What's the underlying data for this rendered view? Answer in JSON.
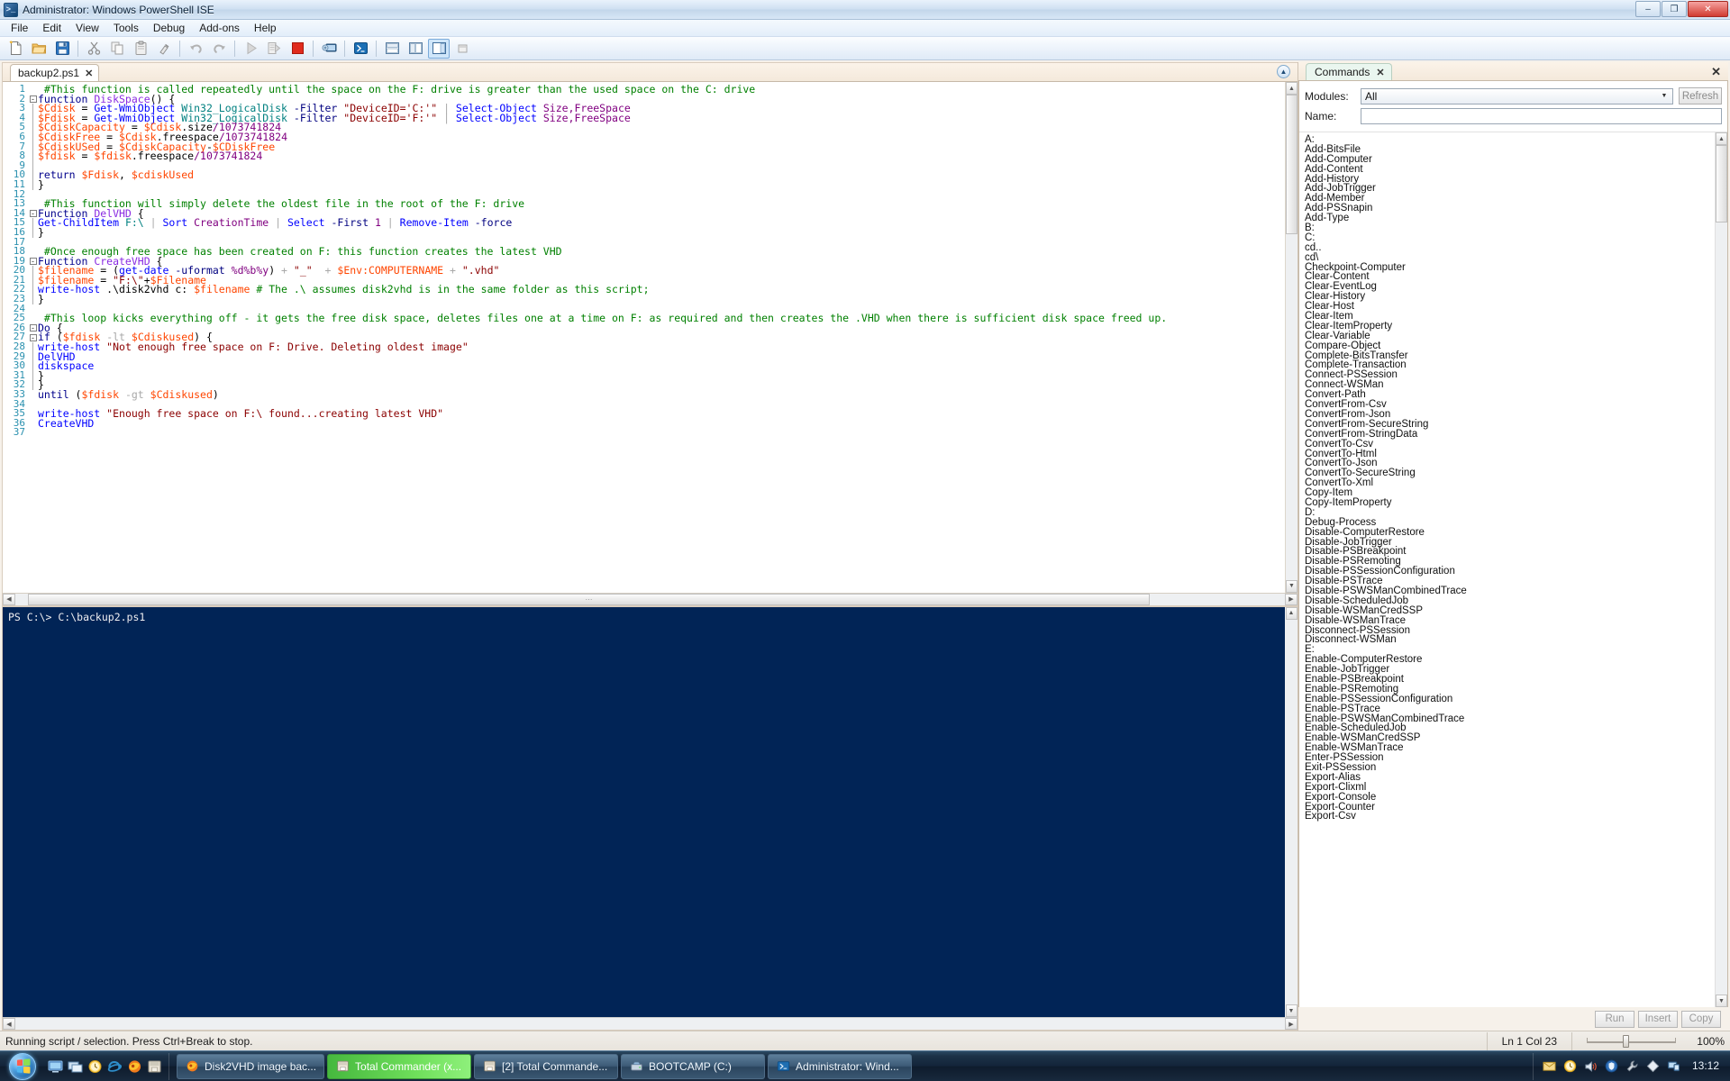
{
  "window": {
    "title": "Administrator: Windows PowerShell ISE",
    "app_icon": "powershell-ise-icon",
    "minimize_label": "–",
    "maximize_label": "❐",
    "close_label": "✕"
  },
  "menu": {
    "items": [
      {
        "label": "File"
      },
      {
        "label": "Edit"
      },
      {
        "label": "View"
      },
      {
        "label": "Tools"
      },
      {
        "label": "Debug"
      },
      {
        "label": "Add-ons"
      },
      {
        "label": "Help"
      }
    ]
  },
  "toolbar": {
    "buttons": [
      {
        "name": "new-script-icon",
        "title": "New"
      },
      {
        "name": "open-folder-icon",
        "title": "Open"
      },
      {
        "name": "save-icon",
        "title": "Save"
      },
      {
        "name": "cut-scissors-icon",
        "title": "Cut"
      },
      {
        "name": "copy-icon",
        "title": "Copy"
      },
      {
        "name": "paste-clipboard-icon",
        "title": "Paste"
      },
      {
        "name": "clear-console-icon",
        "title": "Clear Console Pane"
      },
      {
        "name": "undo-icon",
        "title": "Undo"
      },
      {
        "name": "redo-icon",
        "title": "Redo"
      },
      {
        "name": "run-script-icon",
        "title": "Run Script"
      },
      {
        "name": "run-selection-icon",
        "title": "Run Selection"
      },
      {
        "name": "stop-operation-icon",
        "title": "Stop Operation"
      },
      {
        "name": "new-remote-session-icon",
        "title": "New Remote PowerShell Tab"
      },
      {
        "name": "start-powershell-icon",
        "title": "Start PowerShell.exe"
      },
      {
        "name": "layout-horizontal-icon",
        "title": "Show Script Pane Top"
      },
      {
        "name": "layout-vertical-icon",
        "title": "Show Script Pane Right"
      },
      {
        "name": "show-command-addon-icon",
        "title": "Show Command Add-on"
      },
      {
        "name": "show-commands-pane-icon",
        "title": "Show Commands Pane"
      }
    ]
  },
  "script_pane": {
    "tab_label": "backup2.ps1",
    "tab_close": "✕",
    "collapse_icon": "▲",
    "lines": [
      {
        "n": 1,
        "fold": "",
        "bar": false,
        "tokens": [
          {
            "c": "t-cmt",
            "t": " #This function is called repeatedly until the space on the F: drive is greater than the used space on the C: drive"
          }
        ]
      },
      {
        "n": 2,
        "fold": "-",
        "bar": false,
        "tokens": [
          {
            "c": "t-kw",
            "t": "function "
          },
          {
            "c": "t-fnname",
            "t": "DiskSpace"
          },
          {
            "c": "t-plain",
            "t": "() {"
          }
        ]
      },
      {
        "n": 3,
        "fold": "",
        "bar": true,
        "tokens": [
          {
            "c": "t-var",
            "t": "$Cdisk"
          },
          {
            "c": "t-plain",
            "t": " = "
          },
          {
            "c": "t-cmd",
            "t": "Get-WmiObject "
          },
          {
            "c": "t-type",
            "t": "Win32_LogicalDisk "
          },
          {
            "c": "t-param",
            "t": "-Filter "
          },
          {
            "c": "t-str",
            "t": "\"DeviceID='C:'\""
          },
          {
            "c": "t-op",
            "t": " | "
          },
          {
            "c": "t-cmd",
            "t": "Select-Object "
          },
          {
            "c": "t-attr",
            "t": "Size,FreeSpace"
          }
        ]
      },
      {
        "n": 4,
        "fold": "",
        "bar": true,
        "tokens": [
          {
            "c": "t-var",
            "t": "$Fdisk"
          },
          {
            "c": "t-plain",
            "t": " = "
          },
          {
            "c": "t-cmd",
            "t": "Get-WmiObject "
          },
          {
            "c": "t-type",
            "t": "Win32_LogicalDisk "
          },
          {
            "c": "t-param",
            "t": "-Filter "
          },
          {
            "c": "t-str",
            "t": "\"DeviceID='F:'\""
          },
          {
            "c": "t-op",
            "t": " | "
          },
          {
            "c": "t-cmd",
            "t": "Select-Object "
          },
          {
            "c": "t-attr",
            "t": "Size,FreeSpace"
          }
        ]
      },
      {
        "n": 5,
        "fold": "",
        "bar": true,
        "tokens": [
          {
            "c": "t-var",
            "t": "$CdiskCapacity"
          },
          {
            "c": "t-plain",
            "t": " = "
          },
          {
            "c": "t-var",
            "t": "$Cdisk"
          },
          {
            "c": "t-plain",
            "t": ".size"
          },
          {
            "c": "t-num",
            "t": "/1073741824"
          }
        ]
      },
      {
        "n": 6,
        "fold": "",
        "bar": true,
        "tokens": [
          {
            "c": "t-var",
            "t": "$CdiskFree"
          },
          {
            "c": "t-plain",
            "t": " = "
          },
          {
            "c": "t-var",
            "t": "$Cdisk"
          },
          {
            "c": "t-plain",
            "t": ".freespace"
          },
          {
            "c": "t-num",
            "t": "/1073741824"
          }
        ]
      },
      {
        "n": 7,
        "fold": "",
        "bar": true,
        "tokens": [
          {
            "c": "t-var",
            "t": "$CdiskUSed"
          },
          {
            "c": "t-plain",
            "t": " = "
          },
          {
            "c": "t-var",
            "t": "$CdiskCapacity"
          },
          {
            "c": "t-plain",
            "t": "-"
          },
          {
            "c": "t-var",
            "t": "$CDiskFree"
          }
        ]
      },
      {
        "n": 8,
        "fold": "",
        "bar": true,
        "tokens": [
          {
            "c": "t-var",
            "t": "$fdisk"
          },
          {
            "c": "t-plain",
            "t": " = "
          },
          {
            "c": "t-var",
            "t": "$fdisk"
          },
          {
            "c": "t-plain",
            "t": ".freespace"
          },
          {
            "c": "t-num",
            "t": "/1073741824"
          }
        ]
      },
      {
        "n": 9,
        "fold": "",
        "bar": true,
        "tokens": []
      },
      {
        "n": 10,
        "fold": "",
        "bar": true,
        "tokens": [
          {
            "c": "t-kw",
            "t": "return "
          },
          {
            "c": "t-var",
            "t": "$Fdisk"
          },
          {
            "c": "t-plain",
            "t": ", "
          },
          {
            "c": "t-var",
            "t": "$cdiskUsed"
          }
        ]
      },
      {
        "n": 11,
        "fold": "",
        "bar": true,
        "tokens": [
          {
            "c": "t-plain",
            "t": "}"
          }
        ]
      },
      {
        "n": 12,
        "fold": "",
        "bar": false,
        "tokens": []
      },
      {
        "n": 13,
        "fold": "",
        "bar": false,
        "tokens": [
          {
            "c": "t-cmt",
            "t": " #This function will simply delete the oldest file in the root of the F: drive"
          }
        ]
      },
      {
        "n": 14,
        "fold": "-",
        "bar": false,
        "tokens": [
          {
            "c": "t-kw",
            "t": "Function "
          },
          {
            "c": "t-fnname",
            "t": "DelVHD"
          },
          {
            "c": "t-plain",
            "t": " {"
          }
        ]
      },
      {
        "n": 15,
        "fold": "",
        "bar": true,
        "tokens": [
          {
            "c": "t-cmd",
            "t": "Get-ChildItem "
          },
          {
            "c": "t-type",
            "t": "F:\\"
          },
          {
            "c": "t-op",
            "t": " | "
          },
          {
            "c": "t-cmd",
            "t": "Sort "
          },
          {
            "c": "t-attr",
            "t": "CreationTime"
          },
          {
            "c": "t-op",
            "t": " | "
          },
          {
            "c": "t-cmd",
            "t": "Select "
          },
          {
            "c": "t-param",
            "t": "-First "
          },
          {
            "c": "t-num",
            "t": "1"
          },
          {
            "c": "t-op",
            "t": " | "
          },
          {
            "c": "t-cmd",
            "t": "Remove-Item "
          },
          {
            "c": "t-param",
            "t": "-force"
          }
        ]
      },
      {
        "n": 16,
        "fold": "",
        "bar": true,
        "tokens": [
          {
            "c": "t-plain",
            "t": "}"
          }
        ]
      },
      {
        "n": 17,
        "fold": "",
        "bar": false,
        "tokens": []
      },
      {
        "n": 18,
        "fold": "",
        "bar": false,
        "tokens": [
          {
            "c": "t-cmt",
            "t": " #Once enough free space has been created on F: this function creates the latest VHD"
          }
        ]
      },
      {
        "n": 19,
        "fold": "-",
        "bar": false,
        "tokens": [
          {
            "c": "t-kw",
            "t": "Function "
          },
          {
            "c": "t-fnname",
            "t": "CreateVHD"
          },
          {
            "c": "t-plain",
            "t": " {"
          }
        ]
      },
      {
        "n": 20,
        "fold": "",
        "bar": true,
        "tokens": [
          {
            "c": "t-var",
            "t": "$filename"
          },
          {
            "c": "t-plain",
            "t": " = ("
          },
          {
            "c": "t-cmd",
            "t": "get-date "
          },
          {
            "c": "t-param",
            "t": "-uformat "
          },
          {
            "c": "t-attr",
            "t": "%d%b%y"
          },
          {
            "c": "t-plain",
            "t": ")"
          },
          {
            "c": "t-op",
            "t": " + "
          },
          {
            "c": "t-str",
            "t": "\"_\""
          },
          {
            "c": "t-op",
            "t": "  + "
          },
          {
            "c": "t-var",
            "t": "$Env:COMPUTERNAME"
          },
          {
            "c": "t-op",
            "t": " + "
          },
          {
            "c": "t-str",
            "t": "\".vhd\""
          }
        ]
      },
      {
        "n": 21,
        "fold": "",
        "bar": true,
        "tokens": [
          {
            "c": "t-var",
            "t": "$filename"
          },
          {
            "c": "t-plain",
            "t": " = "
          },
          {
            "c": "t-str",
            "t": "\"F:\\\""
          },
          {
            "c": "t-plain",
            "t": "+"
          },
          {
            "c": "t-var",
            "t": "$Filename"
          }
        ]
      },
      {
        "n": 22,
        "fold": "",
        "bar": true,
        "tokens": [
          {
            "c": "t-cmd",
            "t": "write-host "
          },
          {
            "c": "t-plain",
            "t": ".\\disk2vhd c: "
          },
          {
            "c": "t-var",
            "t": "$filename"
          },
          {
            "c": "t-cmt",
            "t": " # The .\\ assumes disk2vhd is in the same folder as this script;"
          }
        ]
      },
      {
        "n": 23,
        "fold": "",
        "bar": true,
        "tokens": [
          {
            "c": "t-plain",
            "t": "}"
          }
        ]
      },
      {
        "n": 24,
        "fold": "",
        "bar": false,
        "tokens": []
      },
      {
        "n": 25,
        "fold": "",
        "bar": false,
        "tokens": [
          {
            "c": "t-cmt",
            "t": " #This loop kicks everything off - it gets the free disk space, deletes files one at a time on F: as required and then creates the .VHD when there is sufficient disk space freed up."
          }
        ]
      },
      {
        "n": 26,
        "fold": "-",
        "bar": false,
        "tokens": [
          {
            "c": "t-kw",
            "t": "Do"
          },
          {
            "c": "t-plain",
            "t": " {"
          }
        ]
      },
      {
        "n": 27,
        "fold": "-",
        "bar": false,
        "tokens": [
          {
            "c": "t-kw",
            "t": "if"
          },
          {
            "c": "t-plain",
            "t": " ("
          },
          {
            "c": "t-var",
            "t": "$fdisk"
          },
          {
            "c": "t-op",
            "t": " -lt "
          },
          {
            "c": "t-var",
            "t": "$Cdiskused"
          },
          {
            "c": "t-plain",
            "t": ") {"
          }
        ]
      },
      {
        "n": 28,
        "fold": "",
        "bar": true,
        "tokens": [
          {
            "c": "t-cmd",
            "t": "write-host "
          },
          {
            "c": "t-str",
            "t": "\"Not enough free space on F: Drive. Deleting oldest image\""
          }
        ]
      },
      {
        "n": 29,
        "fold": "",
        "bar": true,
        "tokens": [
          {
            "c": "t-cmd",
            "t": "DelVHD"
          }
        ]
      },
      {
        "n": 30,
        "fold": "",
        "bar": true,
        "tokens": [
          {
            "c": "t-cmd",
            "t": "diskspace"
          }
        ]
      },
      {
        "n": 31,
        "fold": "",
        "bar": true,
        "tokens": [
          {
            "c": "t-plain",
            "t": "}"
          }
        ]
      },
      {
        "n": 32,
        "fold": "",
        "bar": true,
        "tokens": [
          {
            "c": "t-plain",
            "t": "}"
          }
        ]
      },
      {
        "n": 33,
        "fold": "",
        "bar": false,
        "tokens": [
          {
            "c": "t-kw",
            "t": "until"
          },
          {
            "c": "t-plain",
            "t": " ("
          },
          {
            "c": "t-var",
            "t": "$fdisk"
          },
          {
            "c": "t-op",
            "t": " -gt "
          },
          {
            "c": "t-var",
            "t": "$Cdiskused"
          },
          {
            "c": "t-plain",
            "t": ")"
          }
        ]
      },
      {
        "n": 34,
        "fold": "",
        "bar": false,
        "tokens": []
      },
      {
        "n": 35,
        "fold": "",
        "bar": false,
        "tokens": [
          {
            "c": "t-cmd",
            "t": "write-host "
          },
          {
            "c": "t-str",
            "t": "\"Enough free space on F:\\ found...creating latest VHD\""
          }
        ]
      },
      {
        "n": 36,
        "fold": "",
        "bar": false,
        "tokens": [
          {
            "c": "t-cmd",
            "t": "CreateVHD"
          }
        ]
      },
      {
        "n": 37,
        "fold": "",
        "bar": false,
        "tokens": []
      }
    ]
  },
  "console": {
    "text": "PS C:\\> C:\\backup2.ps1"
  },
  "commands_pane": {
    "tab_label": "Commands",
    "tab_close": "✕",
    "pane_close": "✕",
    "modules_label": "Modules:",
    "modules_value": "All",
    "refresh_label": "Refresh",
    "name_label": "Name:",
    "name_value": "",
    "run_label": "Run",
    "insert_label": "Insert",
    "copy_label": "Copy",
    "commands": [
      "A:",
      "Add-BitsFile",
      "Add-Computer",
      "Add-Content",
      "Add-History",
      "Add-JobTrigger",
      "Add-Member",
      "Add-PSSnapin",
      "Add-Type",
      "B:",
      "C:",
      "cd..",
      "cd\\",
      "Checkpoint-Computer",
      "Clear-Content",
      "Clear-EventLog",
      "Clear-History",
      "Clear-Host",
      "Clear-Item",
      "Clear-ItemProperty",
      "Clear-Variable",
      "Compare-Object",
      "Complete-BitsTransfer",
      "Complete-Transaction",
      "Connect-PSSession",
      "Connect-WSMan",
      "Convert-Path",
      "ConvertFrom-Csv",
      "ConvertFrom-Json",
      "ConvertFrom-SecureString",
      "ConvertFrom-StringData",
      "ConvertTo-Csv",
      "ConvertTo-Html",
      "ConvertTo-Json",
      "ConvertTo-SecureString",
      "ConvertTo-Xml",
      "Copy-Item",
      "Copy-ItemProperty",
      "D:",
      "Debug-Process",
      "Disable-ComputerRestore",
      "Disable-JobTrigger",
      "Disable-PSBreakpoint",
      "Disable-PSRemoting",
      "Disable-PSSessionConfiguration",
      "Disable-PSTrace",
      "Disable-PSWSManCombinedTrace",
      "Disable-ScheduledJob",
      "Disable-WSManCredSSP",
      "Disable-WSManTrace",
      "Disconnect-PSSession",
      "Disconnect-WSMan",
      "E:",
      "Enable-ComputerRestore",
      "Enable-JobTrigger",
      "Enable-PSBreakpoint",
      "Enable-PSRemoting",
      "Enable-PSSessionConfiguration",
      "Enable-PSTrace",
      "Enable-PSWSManCombinedTrace",
      "Enable-ScheduledJob",
      "Enable-WSManCredSSP",
      "Enable-WSManTrace",
      "Enter-PSSession",
      "Exit-PSSession",
      "Export-Alias",
      "Export-Clixml",
      "Export-Console",
      "Export-Counter",
      "Export-Csv"
    ]
  },
  "statusbar": {
    "message": "Running script / selection.  Press Ctrl+Break to stop.",
    "line_col": "Ln 1  Col 23",
    "zoom_value": "100%"
  },
  "taskbar": {
    "start_label": "start-orb",
    "quick_launch": [
      {
        "name": "show-desktop-icon"
      },
      {
        "name": "switch-windows-icon"
      },
      {
        "name": "clock-gadget-icon"
      },
      {
        "name": "internet-explorer-icon"
      },
      {
        "name": "firefox-icon"
      },
      {
        "name": "total-commander-icon"
      }
    ],
    "tasks": [
      {
        "label": "Disk2VHD image bac...",
        "icon": "firefox-icon",
        "state": "normal"
      },
      {
        "label": "Total Commander (x...",
        "icon": "total-commander-icon",
        "state": "flashing"
      },
      {
        "label": "[2] Total Commande...",
        "icon": "total-commander-icon",
        "state": "normal"
      },
      {
        "label": "BOOTCAMP (C:)",
        "icon": "drive-icon",
        "state": "normal"
      },
      {
        "label": "Administrator: Wind...",
        "icon": "powershell-ise-icon",
        "state": "normal"
      }
    ],
    "tray": [
      {
        "name": "mail-envelope-icon"
      },
      {
        "name": "clock-tray-icon"
      },
      {
        "name": "volume-speaker-icon"
      },
      {
        "name": "shield-security-icon"
      },
      {
        "name": "tools-wrench-icon"
      },
      {
        "name": "diamond-icon"
      },
      {
        "name": "network-monitor-icon"
      }
    ],
    "clock": "13:12"
  }
}
